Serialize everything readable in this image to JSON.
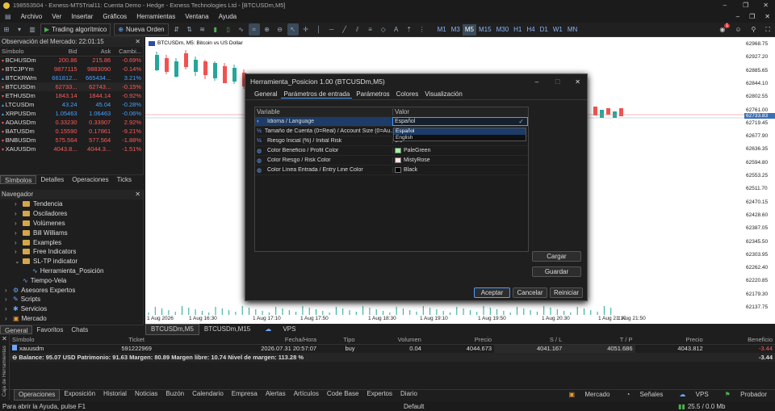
{
  "window": {
    "title": "198553504 - Exness-MT5Trial11: Cuenta Demo - Hedge - Exness Technologies Ltd - [BTCUSDm,M5]"
  },
  "menu": [
    "Archivo",
    "Ver",
    "Insertar",
    "Gráficos",
    "Herramientas",
    "Ventana",
    "Ayuda"
  ],
  "toolbar": {
    "algo_label": "Trading algorítmico",
    "new_order_label": "Nueva Orden",
    "timeframes": [
      "M1",
      "M3",
      "M5",
      "M15",
      "M30",
      "H1",
      "H4",
      "D1",
      "W1",
      "MN"
    ],
    "active_tf": "M5",
    "notif_count": "1"
  },
  "market_watch": {
    "title": "Observación del Mercado: 22:01:15",
    "columns": [
      "Símbolo",
      "Bid",
      "Ask",
      "Cambi..."
    ],
    "rows": [
      {
        "sym": "BCHUSDm",
        "bid": "200.86",
        "ask": "215.86",
        "chg": "-0.69%",
        "dir": "dn"
      },
      {
        "sym": "BTCJPYm",
        "bid": "9877115",
        "ask": "9883090",
        "chg": "-0.14%",
        "dir": "dn"
      },
      {
        "sym": "BTCKRWm",
        "bid": "661812...",
        "ask": "665434...",
        "chg": "3.21%",
        "dir": "up"
      },
      {
        "sym": "BTCUSDm",
        "bid": "62733...",
        "ask": "62743...",
        "chg": "-0.15%",
        "dir": "dn"
      },
      {
        "sym": "ETHUSDm",
        "bid": "1843.14",
        "ask": "1844.14",
        "chg": "-0.92%",
        "dir": "dn"
      },
      {
        "sym": "LTCUSDm",
        "bid": "43.24",
        "ask": "45.04",
        "chg": "-0.28%",
        "dir": "up"
      },
      {
        "sym": "XRPUSDm",
        "bid": "1.05463",
        "ask": "1.06463",
        "chg": "-0.06%",
        "dir": "up"
      },
      {
        "sym": "ADAUSDm",
        "bid": "0.33230",
        "ask": "0.33907",
        "chg": "2.92%",
        "dir": "dn"
      },
      {
        "sym": "BATUSDm",
        "bid": "0.15590",
        "ask": "0.17861",
        "chg": "-9.21%",
        "dir": "dn"
      },
      {
        "sym": "BNBUSDm",
        "bid": "575.564",
        "ask": "577.564",
        "chg": "-1.88%",
        "dir": "dn"
      },
      {
        "sym": "XAUUSDm",
        "bid": "4043.8...",
        "ask": "4044.3...",
        "chg": "-1.51%",
        "dir": "dn"
      }
    ],
    "tabs": [
      "Símbolos",
      "Detalles",
      "Operaciones",
      "Ticks"
    ]
  },
  "navigator": {
    "title": "Navegador",
    "items": [
      "Tendencia",
      "Osciladores",
      "Volúmenes",
      "Bill Williams",
      "Examples",
      "Free Indicators",
      "SL-TP indicator",
      "Herramienta_Posición",
      "Tiempo-Vela",
      "Asesores Expertos",
      "Scripts",
      "Servicios",
      "Mercado"
    ],
    "tabs": [
      "General",
      "Favoritos",
      "Chats"
    ]
  },
  "chart": {
    "symbol_label": "BTCUSDm, M5:  Bitcoin vs US Dollar",
    "price_axis": [
      "62968.75",
      "62927.20",
      "62885.65",
      "62844.10",
      "62802.55",
      "62761.00",
      "62719.45",
      "62677.90",
      "62636.35",
      "62594.80",
      "62553.25",
      "62511.70",
      "62470.15",
      "62428.60",
      "62387.05",
      "62345.50",
      "62303.95",
      "62262.40",
      "62220.85",
      "62179.30",
      "62137.75"
    ],
    "current_price_tag": "62733.83",
    "time_axis": [
      "1 Aug 2026",
      "1 Aug 16:30",
      "1 Aug 17:10",
      "1 Aug 17:50",
      "1 Aug 18:30",
      "1 Aug 19:10",
      "1 Aug 19:50",
      "1 Aug 20:30",
      "1 Aug 21:10",
      "1 Aug 21:50"
    ],
    "tabs": [
      "BTCUSDm,M5",
      "BTCUSDm,M15",
      "VPS"
    ],
    "candle_color_up": "#26a69a",
    "candle_color_down": "#ef5350"
  },
  "dialog": {
    "title": "Herramienta_Posicion 1.00 (BTCUSDm,M5)",
    "tabs": [
      "General",
      "Parámetros de entrada",
      "Parámetros",
      "Colores",
      "Visualización"
    ],
    "col_variable": "Variable",
    "col_value": "Valor",
    "params": [
      {
        "var": "Idioma / Language",
        "val": "Español",
        "icon": "ab"
      },
      {
        "var": "Tamaño de Cuenta (0=Real) / Account Size (0=Au...",
        "val": "0.0",
        "icon": "v2"
      },
      {
        "var": "Riesgo Inicial (%) / Initial Risk",
        "val": "1.0",
        "icon": "v2"
      },
      {
        "var": "Color Beneficio / Profit Color",
        "val": "PaleGreen",
        "icon": "clr",
        "swatch": "#98fb98"
      },
      {
        "var": "Color Riesgo / Risk Color",
        "val": "MistyRose",
        "icon": "clr",
        "swatch": "#ffe4e1"
      },
      {
        "var": "Color Línea Entrada / Entry Line Color",
        "val": "Black",
        "icon": "clr",
        "swatch": "#000000"
      }
    ],
    "dropdown_options": [
      "Español",
      "English"
    ],
    "load_label": "Cargar",
    "save_label": "Guardar",
    "ok_label": "Aceptar",
    "cancel_label": "Cancelar",
    "reset_label": "Reiniciar"
  },
  "terminal": {
    "columns": [
      "Símbolo",
      "Ticket",
      "Fecha/Hora",
      "Tipo",
      "Volumen",
      "Precio",
      "S / L",
      "T / P",
      "Precio",
      "Beneficio"
    ],
    "row": {
      "sym": "xauusdm",
      "ticket": "591222969",
      "time": "2026.07.31 20:57:07",
      "type": "buy",
      "vol": "0.04",
      "price": "4044.673",
      "sl": "4041.167",
      "tp": "4051.686",
      "cur": "4043.812",
      "profit": "-3.44"
    },
    "balance_line": "Balance: 95.07 USD  Patrimonio: 91.63  Margen: 80.89  Margen libre: 10.74  Nivel de margen: 113.28 %",
    "balance_profit": "-3.44",
    "tabs": [
      "Operaciones",
      "Exposición",
      "Historial",
      "Noticias",
      "Buzón",
      "Calendario",
      "Empresa",
      "Alertas",
      "Artículos",
      "Code Base",
      "Expertos",
      "Diario"
    ],
    "right_tabs": [
      "Mercado",
      "Señales",
      "VPS",
      "Probador"
    ],
    "side_label": "Caja de Herramientas"
  },
  "status": {
    "help": "Para abrir la Ayuda, pulse F1",
    "profile": "Default",
    "traffic": "25.5 / 0.0 Mb"
  }
}
